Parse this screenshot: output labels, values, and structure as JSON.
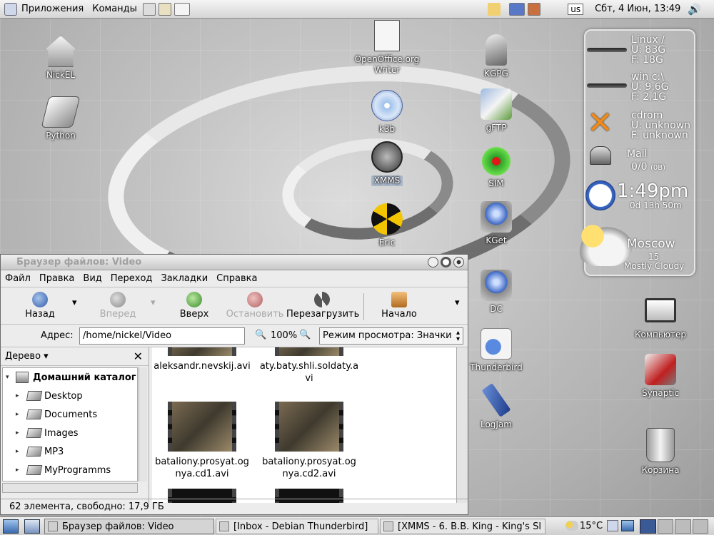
{
  "top_panel": {
    "menus": [
      "Приложения",
      "Команды"
    ],
    "keyboard_layout": "us",
    "clock": "Сбт,  4 Июн, 13:49"
  },
  "desktop_icons": [
    {
      "label": "NickEL",
      "icon": "home-icon"
    },
    {
      "label": "Python",
      "icon": "python-icon"
    },
    {
      "label": "OpenOffice.org Writer",
      "icon": "writer-icon"
    },
    {
      "label": "k3b",
      "icon": "k3b-icon"
    },
    {
      "label": "XMMS",
      "icon": "xmms-icon"
    },
    {
      "label": "Eric",
      "icon": "eric-icon"
    },
    {
      "label": "KGPG",
      "icon": "keys-icon"
    },
    {
      "label": "gFTP",
      "icon": "gftp-icon"
    },
    {
      "label": "SIM",
      "icon": "sim-icon"
    },
    {
      "label": "KGet",
      "icon": "kget-icon"
    },
    {
      "label": "DC",
      "icon": "dc-icon"
    },
    {
      "label": "Thunderbird",
      "icon": "thunderbird-icon"
    },
    {
      "label": "LogJam",
      "icon": "logjam-icon"
    },
    {
      "label": "Компьютер",
      "icon": "computer-icon"
    },
    {
      "label": "Synaptic",
      "icon": "synaptic-icon"
    },
    {
      "label": "Корзина",
      "icon": "trash-icon"
    }
  ],
  "monitor_widget": {
    "linux": {
      "title": "Linux /",
      "used": "U: 83G",
      "free": "F: 18G"
    },
    "win": {
      "title": "win c:\\",
      "used": "U: 9,6G",
      "free": "F: 2,1G"
    },
    "cdrom": {
      "title": "cdrom",
      "used": "U: unknown",
      "free": "F: unknown"
    },
    "mail": {
      "title": "Mail",
      "count": "0/0",
      "size": "(0B)"
    },
    "clock": {
      "time": "1:49pm",
      "uptime": "0d 13h 50m"
    },
    "weather": {
      "city": "Moscow",
      "temp": "15",
      "condition": "Mostly Cloudy"
    }
  },
  "file_manager": {
    "title": "Браузер файлов: Video",
    "menu": [
      "Файл",
      "Правка",
      "Вид",
      "Переход",
      "Закладки",
      "Справка"
    ],
    "toolbar": {
      "back": "Назад",
      "forward": "Вперед",
      "up": "Вверх",
      "stop": "Остановить",
      "reload": "Перезагрузить",
      "home": "Начало"
    },
    "address_label": "Адрес:",
    "address_value": "/home/nickel/Video",
    "zoom": "100%",
    "view_mode": "Режим просмотра: Значки",
    "sidebar_title": "Дерево",
    "tree": {
      "root": "Домашний каталог",
      "items": [
        "Desktop",
        "Documents",
        "Images",
        "MP3",
        "MyProgramms"
      ]
    },
    "files": [
      {
        "name": "aleksandr.nevskij.avi"
      },
      {
        "name": "aty.baty.shli.soldaty.avi"
      },
      {
        "name": "bataliony.prosyat.ognya.cd1.avi"
      },
      {
        "name": "bataliony.prosyat.ognya.cd2.avi"
      }
    ],
    "status": "62 элемента, свободно: 17,9 ГБ"
  },
  "bottom_panel": {
    "tasks": [
      "Браузер файлов: Video",
      "[Inbox - Debian Thunderbird]",
      "[XMMS - 6. В.В. King - King's Sl"
    ],
    "temperature": "15°C"
  }
}
